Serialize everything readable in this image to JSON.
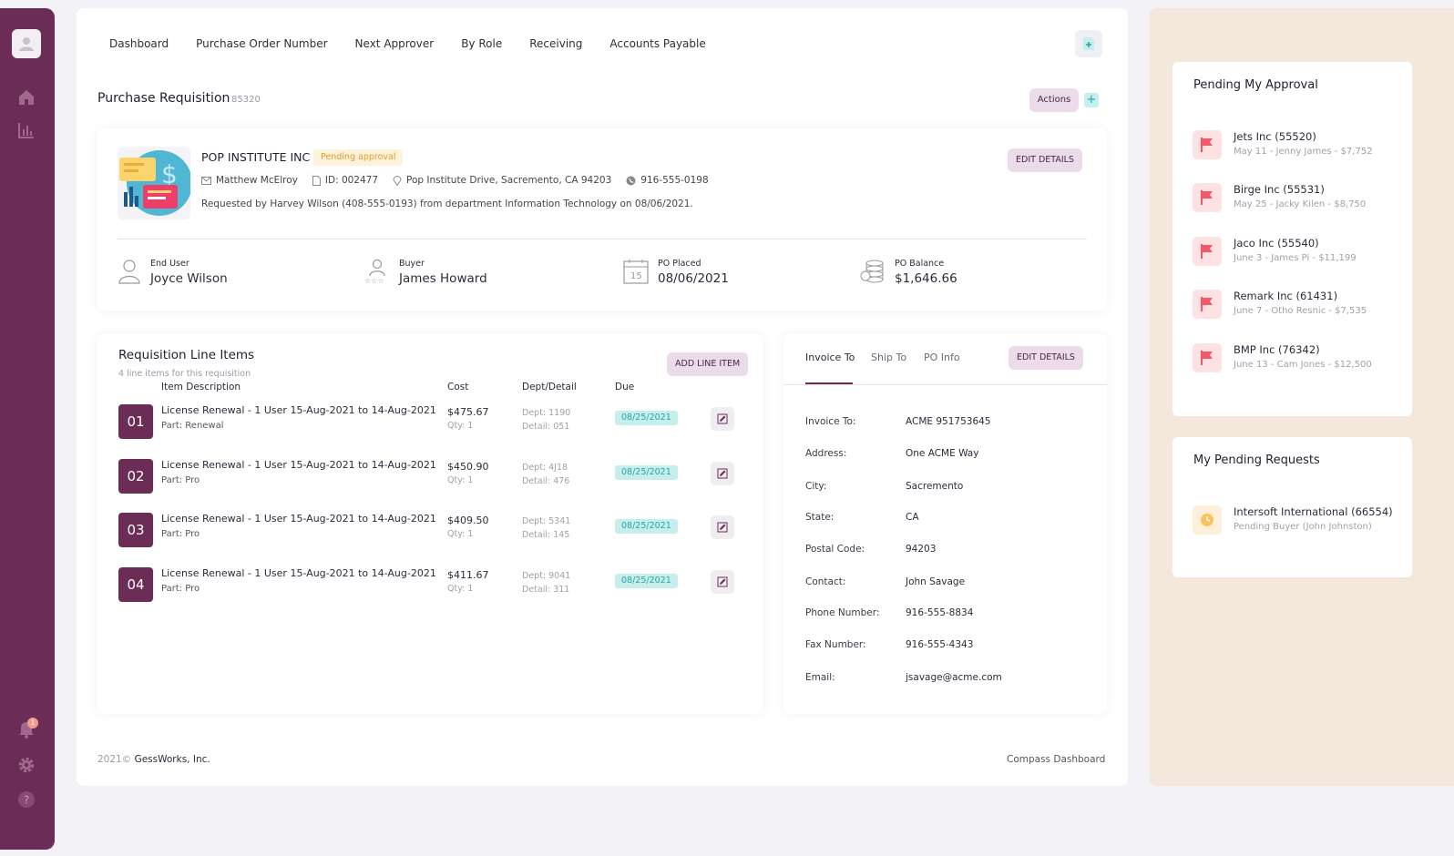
{
  "colors": {
    "sidebar": "#6b2c55",
    "accent_teal": "#28a6a0",
    "pending_orange": "#e69a2a",
    "right_panel_bg": "#f4e8dc"
  },
  "sidebar": {
    "notification_count": "1"
  },
  "nav": [
    "Dashboard",
    "Purchase Order Number",
    "Next Approver",
    "By Role",
    "Receiving",
    "Accounts Payable"
  ],
  "requisition": {
    "title": "Purchase Requisition",
    "number": "85320",
    "actions_label": "Actions",
    "plus_label": "+"
  },
  "vendor": {
    "name": "POP INSTITUTE INC",
    "status": "Pending approval",
    "contact": "Matthew McElroy",
    "id": "ID: 002477",
    "address": "Pop Institute Drive, Sacremento, CA 94203",
    "phone": "916-555-0198",
    "requested_by": "Requested by Harvey Wilson (408-555-0193) from department Information Technology on 08/06/2021.",
    "edit_label": "EDIT DETAILS",
    "stats": [
      {
        "label": "End User",
        "value": "Joyce Wilson",
        "icon": "user-icon"
      },
      {
        "label": "Buyer",
        "value": "James Howard",
        "icon": "buyer-rating-icon"
      },
      {
        "label": "PO Placed",
        "value": "08/06/2021",
        "icon": "calendar-icon"
      },
      {
        "label": "PO Balance",
        "value": "$1,646.66",
        "icon": "coins-icon"
      }
    ]
  },
  "line_items": {
    "title": "Requisition Line Items",
    "subtitle": "4 line items for this requisition",
    "add_label": "ADD LINE ITEM",
    "headers": {
      "desc": "Item Description",
      "cost": "Cost",
      "dept": "Dept/Detail",
      "due": "Due"
    },
    "rows": [
      {
        "num": "01",
        "desc": "License Renewal - 1 User 15-Aug-2021 to 14-Aug-2021",
        "part": "Part: Renewal",
        "cost": "$475.67",
        "qty": "Qty: 1",
        "dept": "Dept: 1190",
        "detail": "Detail: 051",
        "due": "08/25/2021"
      },
      {
        "num": "02",
        "desc": "License Renewal - 1 User 15-Aug-2021 to 14-Aug-2021",
        "part": "Part: Pro",
        "cost": "$450.90",
        "qty": "Qty: 1",
        "dept": "Dept: 4J18",
        "detail": "Detail: 476",
        "due": "08/25/2021"
      },
      {
        "num": "03",
        "desc": "License Renewal - 1 User 15-Aug-2021 to 14-Aug-2021",
        "part": "Part: Pro",
        "cost": "$409.50",
        "qty": "Qty: 1",
        "dept": "Dept: 5341",
        "detail": "Detail: 145",
        "due": "08/25/2021"
      },
      {
        "num": "04",
        "desc": "License Renewal - 1 User 15-Aug-2021 to 14-Aug-2021",
        "part": "Part: Pro",
        "cost": "$411.67",
        "qty": "Qty: 1",
        "dept": "Dept: 9041",
        "detail": "Detail: 311",
        "due": "08/25/2021"
      }
    ]
  },
  "invoice": {
    "tabs": [
      "Invoice To",
      "Ship To",
      "PO Info"
    ],
    "active_tab": "Invoice To",
    "edit_label": "EDIT DETAILS",
    "fields": [
      {
        "label": "Invoice To:",
        "value": "ACME 951753645"
      },
      {
        "label": "Address:",
        "value": "One ACME Way"
      },
      {
        "label": "City:",
        "value": "Sacremento"
      },
      {
        "label": "State:",
        "value": "CA"
      },
      {
        "label": "Postal Code:",
        "value": "94203"
      },
      {
        "label": "Contact:",
        "value": "John Savage"
      },
      {
        "label": "Phone Number:",
        "value": "916-555-8834"
      },
      {
        "label": "Fax Number:",
        "value": "916-555-4343"
      },
      {
        "label": "Email:",
        "value": "jsavage@acme.com"
      }
    ]
  },
  "footer": {
    "year": "2021©",
    "company": "GessWorks, Inc.",
    "app": "Compass Dashboard"
  },
  "pending_approval": {
    "title": "Pending My Approval",
    "items": [
      {
        "name": "Jets Inc (55520)",
        "sub": "May 11 - Jenny James - $7,752"
      },
      {
        "name": "Birge Inc (55531)",
        "sub": "May 25 - Jacky Kilen - $8,750"
      },
      {
        "name": "Jaco Inc (55540)",
        "sub": "June 3 - James Pi - $11,199"
      },
      {
        "name": "Remark Inc (61431)",
        "sub": "June 7 - Otho Resnic - $7,535"
      },
      {
        "name": "BMP Inc (76342)",
        "sub": "June 13 - Cam Jones - $12,500"
      }
    ]
  },
  "pending_requests": {
    "title": "My Pending Requests",
    "items": [
      {
        "name": "Intersoft International (66554)",
        "sub": "Pending Buyer (John Johnston)"
      }
    ]
  }
}
